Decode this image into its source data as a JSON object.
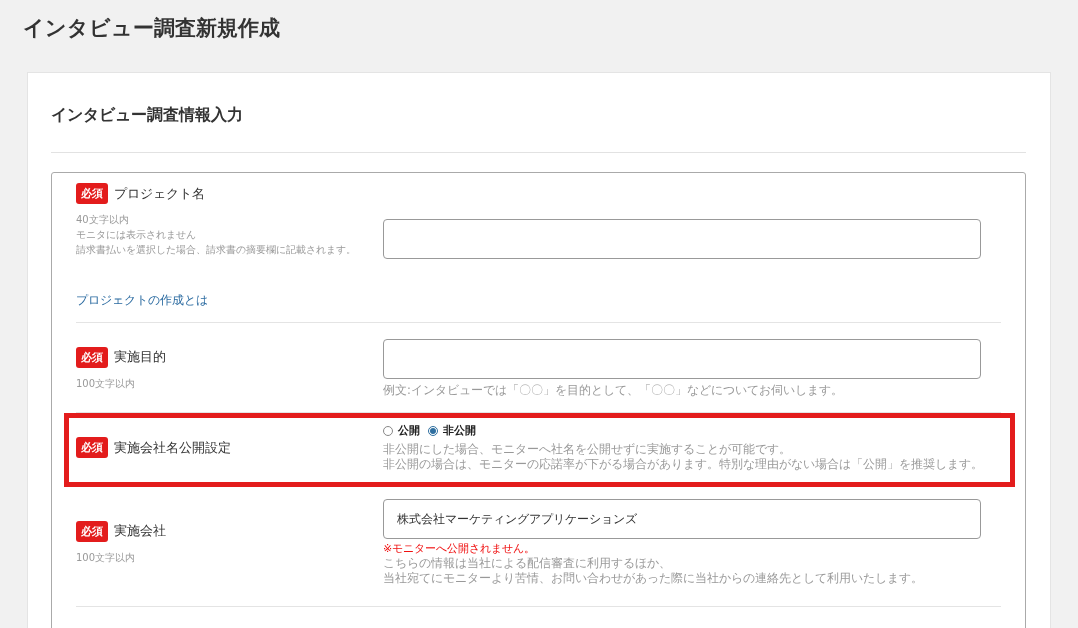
{
  "page_title": "インタビュー調査新規作成",
  "section_title": "インタビュー調査情報入力",
  "fields": [
    {
      "kind": "text",
      "required_badge": "必須",
      "label": "プロジェクト名",
      "notes": [
        "40文字以内",
        "モニタには表示されません",
        "請求書払いを選択した場合、請求書の摘要欄に記載されます。"
      ],
      "link": "プロジェクトの作成とは",
      "highlighted": false
    },
    {
      "kind": "text",
      "required_badge": "必須",
      "label": "実施目的",
      "notes": [
        "100文字以内"
      ],
      "help": [
        "例文:インタビューでは「〇〇」を目的として、「〇〇」などについてお伺いします。"
      ],
      "highlighted": false
    },
    {
      "kind": "radio",
      "required_badge": "必須",
      "label": "実施会社名公開設定",
      "options": [
        {
          "label": "公開",
          "selected": false
        },
        {
          "label": "非公開",
          "selected": true
        }
      ],
      "help": [
        "非公開にした場合、モニターへ社名を公開せずに実施することが可能です。",
        "非公開の場合は、モニターの応諾率が下がる場合があります。特別な理由がない場合は「公開」を推奨します。"
      ],
      "highlighted": true
    },
    {
      "kind": "text",
      "required_badge": "必須",
      "label": "実施会社",
      "notes": [
        "100文字以内"
      ],
      "value": "株式会社マーケティングアプリケーションズ",
      "warning": "※モニターへ公開されません。",
      "help": [
        "こちらの情報は当社による配信審査に利用するほか、",
        "当社宛てにモニターより苦情、お問い合わせがあった際に当社からの連絡先として利用いたします。"
      ],
      "highlighted": false
    }
  ]
}
